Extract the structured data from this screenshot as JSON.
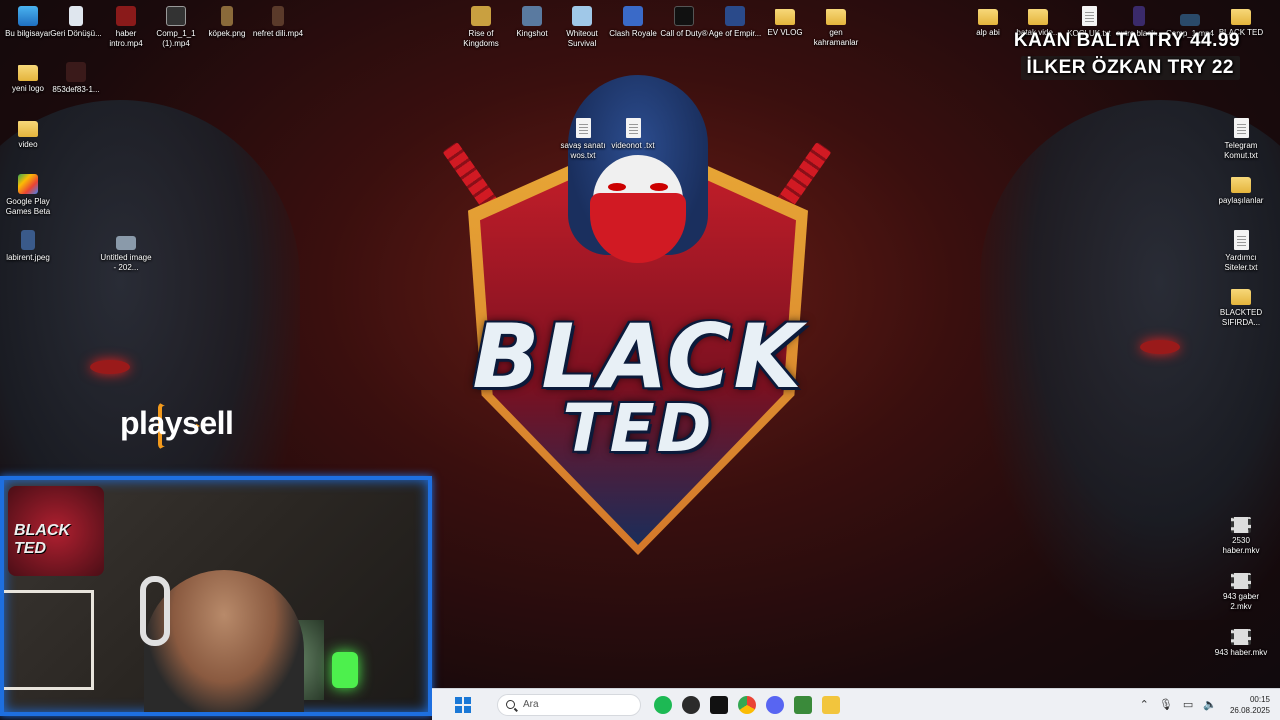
{
  "desktop": {
    "left_icons": [
      {
        "label": "Bu bilgisayar",
        "icon": "monitor-icon"
      },
      {
        "label": "Geri Dönüşü...",
        "icon": "recycle-bin-icon"
      },
      {
        "label": "haber intro.mp4",
        "icon": "video-file-icon"
      },
      {
        "label": "Comp_1_1 (1).mp4",
        "icon": "video-file-icon"
      },
      {
        "label": "köpek.png",
        "icon": "image-file-icon"
      },
      {
        "label": "nefret dili.mp4",
        "icon": "video-file-icon"
      },
      {
        "label": "yeni logo",
        "icon": "folder-icon"
      },
      {
        "label": "853def83-1...",
        "icon": "image-file-icon"
      },
      {
        "label": "video",
        "icon": "folder-icon"
      },
      {
        "label": "Google Play Games Beta",
        "icon": "google-play-icon"
      },
      {
        "label": "labirent.jpeg",
        "icon": "image-file-icon"
      },
      {
        "label": "Untitled image - 202...",
        "icon": "image-file-icon"
      }
    ],
    "top_icons": [
      {
        "label": "Rise of Kingdoms",
        "icon": "rise-of-kingdoms-icon"
      },
      {
        "label": "Kingshot",
        "icon": "kingshot-icon"
      },
      {
        "label": "Whiteout Survival",
        "icon": "whiteout-survival-icon"
      },
      {
        "label": "Clash Royale",
        "icon": "clash-royale-icon"
      },
      {
        "label": "Call of Duty®",
        "icon": "call-of-duty-icon"
      },
      {
        "label": "Age of Empir...",
        "icon": "age-of-empires-icon"
      },
      {
        "label": "EV VLOG",
        "icon": "folder-icon"
      },
      {
        "label": "gen kahramanlar",
        "icon": "folder-icon"
      }
    ],
    "center_files": [
      {
        "label": "savaş sanatı wos.txt",
        "icon": "text-file-icon"
      },
      {
        "label": "videonot .txt",
        "icon": "text-file-icon"
      }
    ],
    "right_top_icons": [
      {
        "label": "alp abi",
        "icon": "folder-icon"
      },
      {
        "label": "batak vide...",
        "icon": "folder-icon"
      },
      {
        "label": "KOÇLUK.txt",
        "icon": "text-file-icon"
      },
      {
        "label": "outro black...",
        "icon": "video-file-icon"
      },
      {
        "label": "Comp_1.mp4",
        "icon": "video-file-icon"
      },
      {
        "label": "BLACK TED",
        "icon": "folder-icon"
      }
    ],
    "right_column_icons": [
      {
        "label": "Telegram Komut.txt",
        "icon": "text-file-icon"
      },
      {
        "label": "paylaşılanlar",
        "icon": "folder-icon"
      },
      {
        "label": "Yardımcı Siteler.txt",
        "icon": "text-file-icon"
      },
      {
        "label": "BLACKTED SIFIRDA...",
        "icon": "folder-icon"
      },
      {
        "label": "2530 haber.mkv",
        "icon": "video-file-icon"
      },
      {
        "label": "943 gaber 2.mkv",
        "icon": "video-file-icon"
      },
      {
        "label": "943 haber.mkv",
        "icon": "video-file-icon"
      }
    ]
  },
  "wallpaper": {
    "logo_line1": "BLACK",
    "logo_line2": "TED"
  },
  "overlay": {
    "donation1": "KAAN BALTA  TRY 44.99",
    "donation2": "İLKER ÖZKAN  TRY 22",
    "sponsor": "playsell"
  },
  "webcam": {
    "poster_text": "BLACK TED"
  },
  "taskbar": {
    "search_placeholder": "Ara",
    "apps": [
      {
        "name": "spotify-icon",
        "color": "#1db954"
      },
      {
        "name": "obs-icon",
        "color": "#2b2b2b"
      },
      {
        "name": "capcut-icon",
        "color": "#111111"
      },
      {
        "name": "chrome-icon",
        "color": "#e94235"
      },
      {
        "name": "discord-icon",
        "color": "#5865f2"
      },
      {
        "name": "game-launcher-icon",
        "color": "#3a8a3a"
      },
      {
        "name": "file-explorer-icon",
        "color": "#f2c53d"
      }
    ],
    "time": "00:15",
    "date": "26.08.2025"
  }
}
